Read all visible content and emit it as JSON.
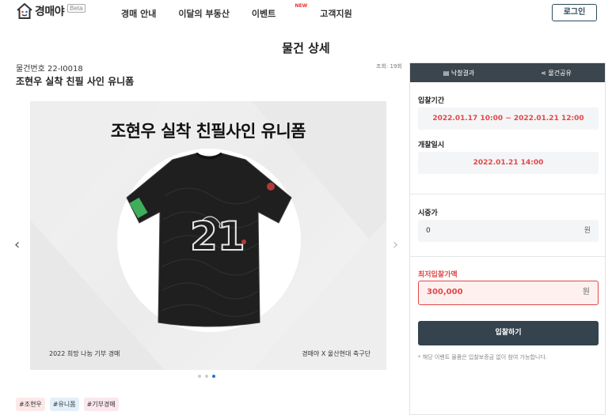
{
  "brand": {
    "name": "경매야",
    "beta": "Beta"
  },
  "nav": {
    "items": [
      "경매 안내",
      "이달의 부동산",
      "이벤트",
      "고객지원"
    ],
    "new_badge": "NEW",
    "login": "로그인"
  },
  "page": {
    "title": "물건 상세"
  },
  "item": {
    "number": "물건번호 22-I0018",
    "views": "조회: 19회",
    "title": "조현우 실착 친필 사인 유니폼"
  },
  "banner": {
    "headline": "조현우 실착 친필사인 유니폼",
    "jersey_number": "21",
    "footer_left": "2022 희망 나눔 기부 경매",
    "footer_right": "경매야 X 울산현대 축구단"
  },
  "carousel": {
    "prev": "‹",
    "next": "›",
    "active_index": 2,
    "count": 3
  },
  "tags": [
    "#조현우",
    "#유니폼",
    "#기부경매"
  ],
  "sidebar": {
    "tab_result": "낙찰결과",
    "tab_share": "물건공유",
    "bid_period_label": "입찰기간",
    "bid_period_value": "2022.01.17 10:00 ~ 2022.01.21 12:00",
    "open_time_label": "개찰일시",
    "open_time_value": "2022.01.21 14:00",
    "market_price_label": "시중가",
    "market_price_value": "0",
    "currency": "원",
    "min_bid_label": "최저입찰가액",
    "min_bid_value": "300,000",
    "bid_button": "입찰하기",
    "note": "* 해당 이벤트 물품은 입찰보증금 없이 참여 가능합니다."
  },
  "colors": {
    "accent_red": "#e24848",
    "dark_button": "#34434d",
    "header_dark": "#3b454d",
    "dot_active": "#2a6fd8"
  }
}
